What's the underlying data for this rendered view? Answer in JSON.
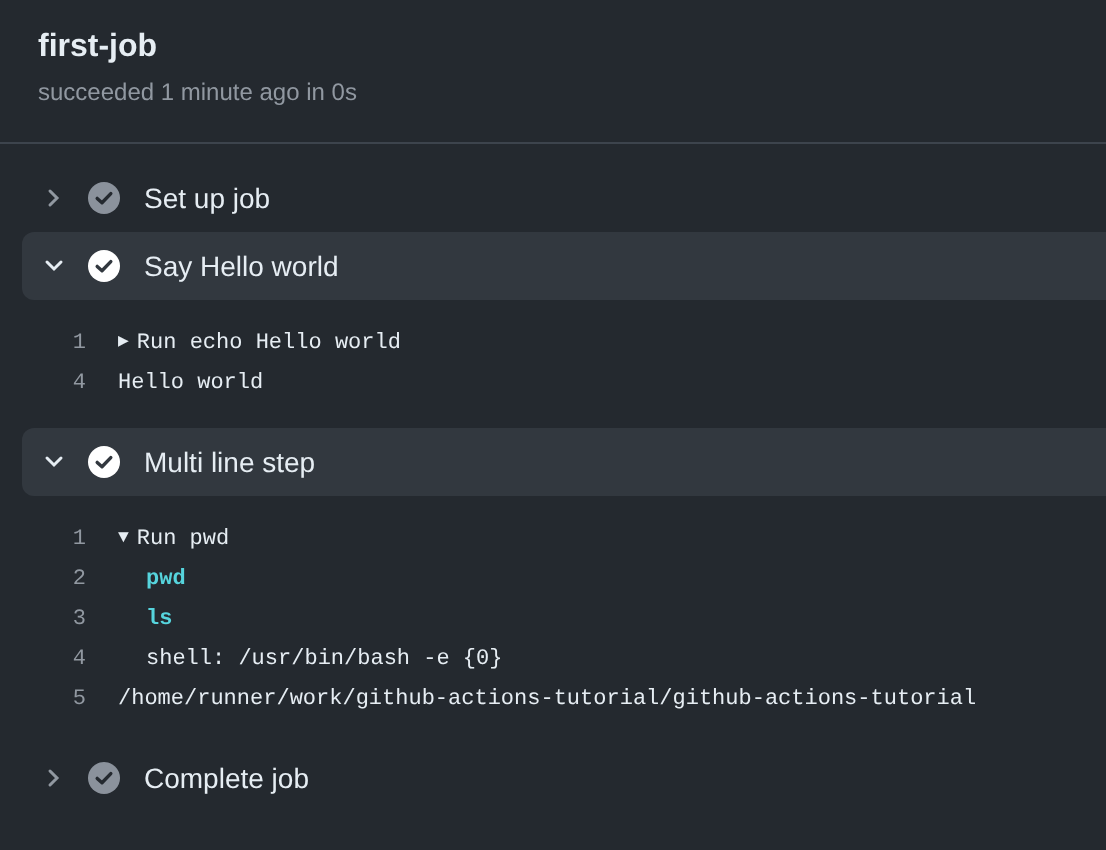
{
  "job": {
    "title": "first-job",
    "subtitle": "succeeded 1 minute ago in 0s"
  },
  "steps": [
    {
      "name": "Set up job",
      "expanded": false
    },
    {
      "name": "Say Hello world",
      "expanded": true,
      "lines": [
        {
          "number": "1",
          "toggle": "▶",
          "text": "Run echo Hello world",
          "kind": "plain"
        },
        {
          "number": "4",
          "text": "Hello world",
          "kind": "plain"
        }
      ]
    },
    {
      "name": "Multi line step",
      "expanded": true,
      "lines": [
        {
          "number": "1",
          "toggle": "▼",
          "text": "Run pwd",
          "kind": "plain",
          "children": [
            {
              "number": "2",
              "text": "pwd",
              "kind": "command"
            },
            {
              "number": "3",
              "text": "ls",
              "kind": "command"
            },
            {
              "number": "4",
              "text": "shell: /usr/bin/bash -e {0}",
              "kind": "plain"
            }
          ]
        },
        {
          "number": "5",
          "text": "/home/runner/work/github-actions-tutorial/github-actions-tutorial",
          "kind": "plain"
        }
      ]
    },
    {
      "name": "Complete job",
      "expanded": false
    }
  ]
}
